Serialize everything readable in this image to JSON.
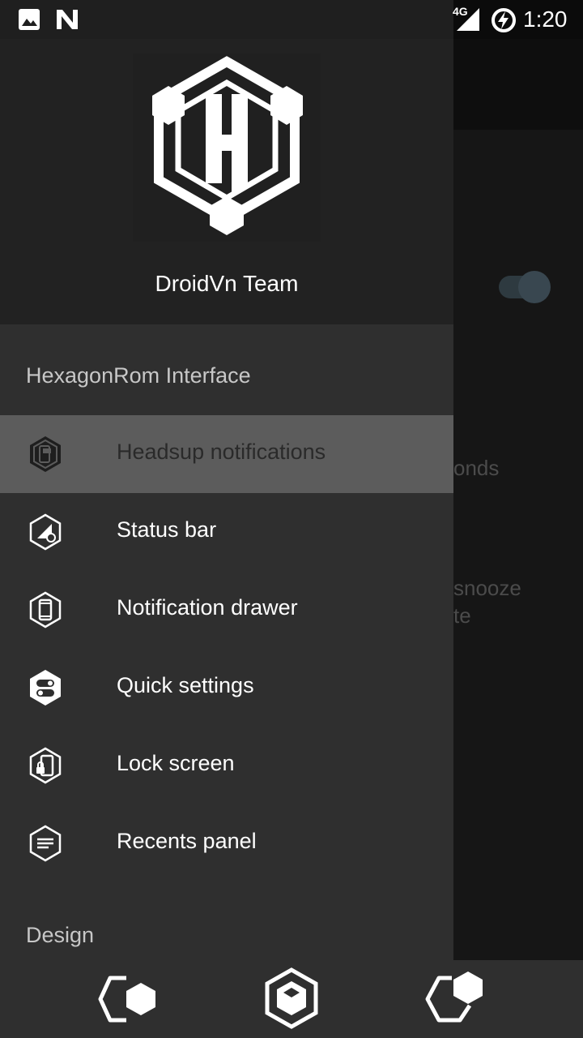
{
  "status_bar": {
    "network": "4G",
    "time": "1:20",
    "icons": [
      "gallery-icon",
      "n-icon",
      "signal-icon",
      "battery-charging-icon"
    ]
  },
  "drawer": {
    "team_name": "DroidVn Team",
    "logo_letter": "H",
    "section_interface": "HexagonRom Interface",
    "items": [
      {
        "label": "Headsup notifications",
        "icon": "headsup-hex-icon",
        "selected": true
      },
      {
        "label": "Status bar",
        "icon": "statusbar-hex-icon",
        "selected": false
      },
      {
        "label": "Notification drawer",
        "icon": "phone-hex-icon",
        "selected": false
      },
      {
        "label": "Quick settings",
        "icon": "toggles-hex-icon",
        "selected": false
      },
      {
        "label": "Lock screen",
        "icon": "lock-hex-icon",
        "selected": false
      },
      {
        "label": "Recents panel",
        "icon": "recents-hex-icon",
        "selected": false
      }
    ],
    "section_design": "Design"
  },
  "background": {
    "text_1": "onds",
    "text_2": "snooze",
    "text_3": "te"
  },
  "colors": {
    "drawer_bg": "#2f2f2f",
    "header_bg": "#222222",
    "selected_bg": "#5c5c5c"
  }
}
